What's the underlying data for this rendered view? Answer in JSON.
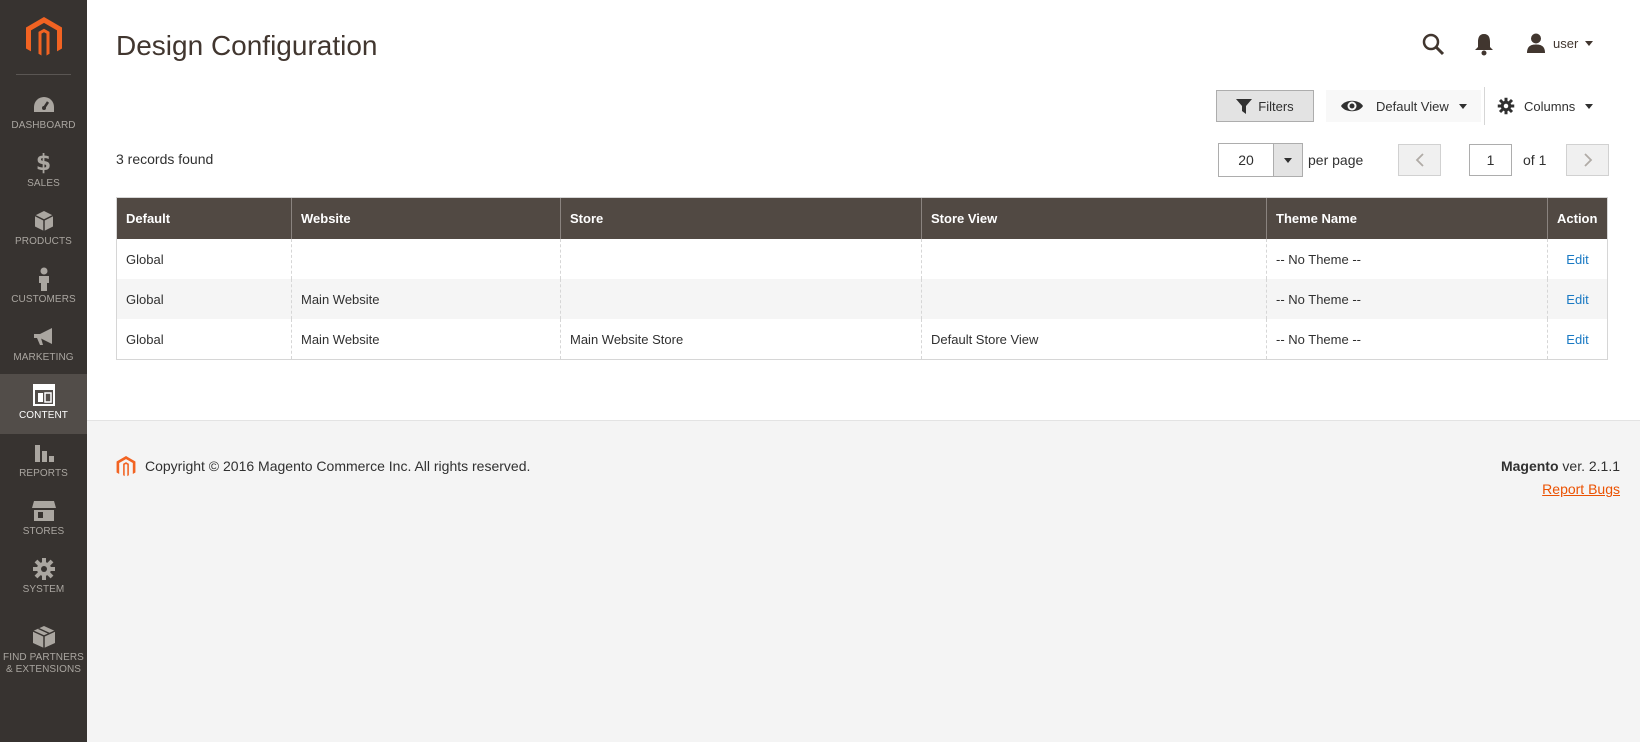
{
  "page": {
    "title": "Design Configuration"
  },
  "sidebar": {
    "items": [
      {
        "id": "dashboard",
        "label": "DASHBOARD",
        "icon": "dashboard-icon"
      },
      {
        "id": "sales",
        "label": "SALES",
        "icon": "dollar-icon"
      },
      {
        "id": "products",
        "label": "PRODUCTS",
        "icon": "box-icon"
      },
      {
        "id": "customers",
        "label": "CUSTOMERS",
        "icon": "person-icon"
      },
      {
        "id": "marketing",
        "label": "MARKETING",
        "icon": "megaphone-icon"
      },
      {
        "id": "content",
        "label": "CONTENT",
        "icon": "layout-icon",
        "active": true
      },
      {
        "id": "reports",
        "label": "REPORTS",
        "icon": "bar-chart-icon"
      },
      {
        "id": "stores",
        "label": "STORES",
        "icon": "storefront-icon"
      },
      {
        "id": "system",
        "label": "SYSTEM",
        "icon": "gear-icon"
      },
      {
        "id": "partners",
        "label": "FIND PARTNERS\n& EXTENSIONS",
        "label_line1": "FIND PARTNERS",
        "label_line2": "& EXTENSIONS",
        "icon": "cubes-icon"
      }
    ]
  },
  "header": {
    "user_name": "user"
  },
  "toolbar": {
    "filters_label": "Filters",
    "view_label": "Default View",
    "columns_label": "Columns"
  },
  "records_found": "3 records found",
  "pagination": {
    "per_page_value": "20",
    "per_page_label": "per page",
    "current_page": "1",
    "of_label": "of 1"
  },
  "grid": {
    "columns": [
      "Default",
      "Website",
      "Store",
      "Store View",
      "Theme Name",
      "Action"
    ],
    "rows": [
      [
        "Global",
        "",
        "",
        "",
        "-- No Theme --",
        "Edit"
      ],
      [
        "Global",
        "Main Website",
        "",
        "",
        "-- No Theme --",
        "Edit"
      ],
      [
        "Global",
        "Main Website",
        "Main Website Store",
        "Default Store View",
        "-- No Theme --",
        "Edit"
      ]
    ]
  },
  "footer": {
    "copyright": "Copyright © 2016 Magento Commerce Inc. All rights reserved.",
    "brand": "Magento",
    "version": " ver. 2.1.1",
    "report_bugs": "Report Bugs"
  },
  "colors": {
    "sidebar_bg": "#373330",
    "grid_header_bg": "#514943",
    "accent_orange": "#eb5202",
    "link_blue": "#1979c3"
  }
}
